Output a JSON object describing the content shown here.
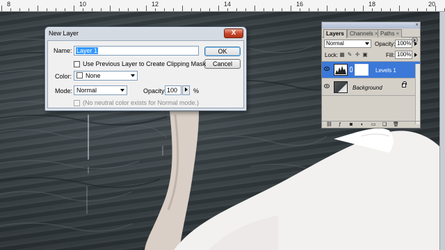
{
  "ruler": {
    "labels": [
      "8",
      "10",
      "12",
      "14",
      "16",
      "18",
      "20"
    ]
  },
  "dialog": {
    "title": "New Layer",
    "close_label": "X",
    "name_label": "Name:",
    "name_value": "Layer 1",
    "use_previous_label": "Use Previous Layer to Create Clipping Mask",
    "color_label": "Color:",
    "color_value": "None",
    "mode_label": "Mode:",
    "mode_value": "Normal",
    "opacity_label": "Opacity:",
    "opacity_value": "100",
    "opacity_unit": "%",
    "neutral_text": "(No neutral color exists for Normal mode.)",
    "ok_label": "OK",
    "cancel_label": "Cancel"
  },
  "layers_panel": {
    "tabs": [
      {
        "label": "Layers",
        "active": true
      },
      {
        "label": "Channels",
        "active": false
      },
      {
        "label": "Paths",
        "active": false
      }
    ],
    "tab_close": "×",
    "panel_close": "×",
    "blend_mode": "Normal",
    "opacity_label": "Opacity:",
    "opacity_value": "100%",
    "lock_label": "Lock:",
    "fill_label": "Fill:",
    "fill_value": "100%",
    "layers": [
      {
        "name": "Levels 1",
        "selected": true
      },
      {
        "name": "Background",
        "selected": false
      }
    ]
  },
  "colors": {
    "selection_blue": "#3b78d8",
    "dialog_close_red": "#c8442a"
  }
}
